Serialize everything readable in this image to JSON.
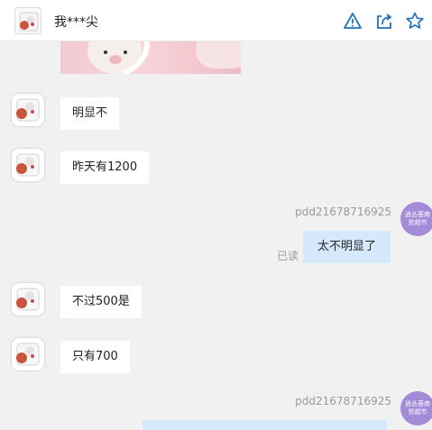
{
  "header": {
    "title": "我***尖",
    "icons": [
      "warning-icon",
      "share-icon",
      "star-icon"
    ],
    "accent_color": "#1e73be"
  },
  "messages": [
    {
      "side": "in",
      "text": "明显不"
    },
    {
      "side": "in",
      "text": "昨天有1200"
    },
    {
      "side": "out",
      "sender": "pdd21678716925",
      "text": "太不明显了",
      "read_label": "已读"
    },
    {
      "side": "in",
      "text": "不过500是"
    },
    {
      "side": "in",
      "text": "只有700"
    },
    {
      "side": "out",
      "sender": "pdd21678716925",
      "text": ""
    }
  ],
  "shop_avatar_text": "逍丛荟商贸超市"
}
